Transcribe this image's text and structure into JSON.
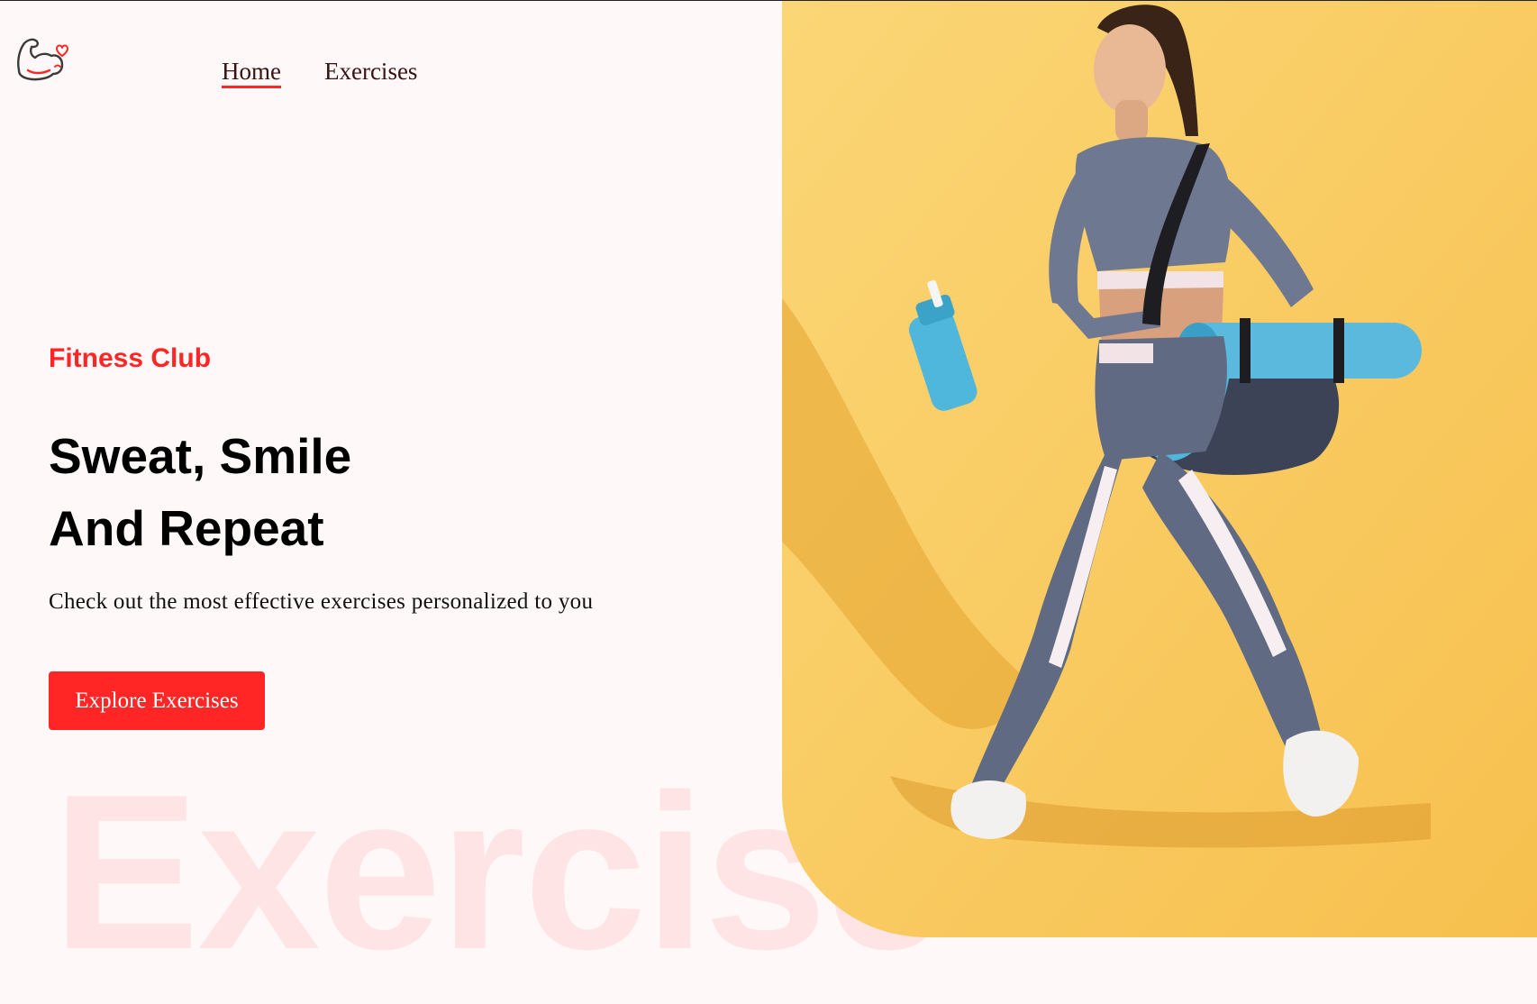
{
  "header": {
    "logo_icon": "flexed-arm-heart-icon",
    "nav": [
      {
        "label": "Home",
        "active": true
      },
      {
        "label": "Exercises",
        "active": false
      }
    ]
  },
  "hero": {
    "eyebrow": "Fitness Club",
    "headline_line1": "Sweat, Smile",
    "headline_line2": "And Repeat",
    "subtitle": "Check out the most effective exercises personalized to you",
    "cta_label": "Explore Exercises",
    "watermark": "Exercise"
  },
  "banner": {
    "image": "woman-walking-with-gym-bag-and-yoga-mat"
  },
  "colors": {
    "accent": "#ff2625",
    "page_background": "#fff8f9",
    "banner_background": "#f9c95a",
    "text": "#000000"
  }
}
